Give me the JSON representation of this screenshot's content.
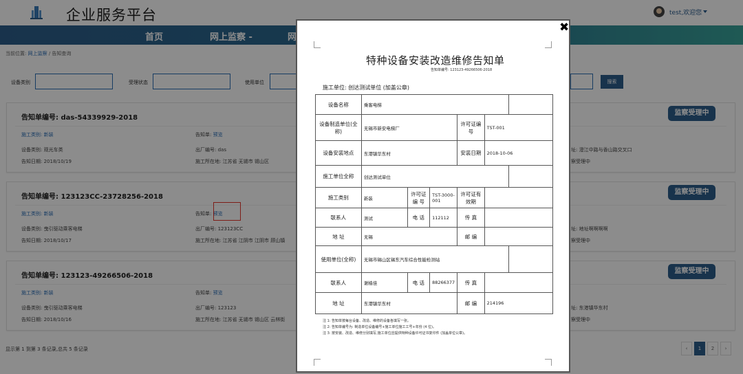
{
  "header": {
    "app_title": "企业服务平台",
    "user_label": "test,欢迎您"
  },
  "nav": {
    "items": [
      "首页",
      "网上监察 -",
      "网"
    ]
  },
  "breadcrumb": {
    "prefix": "当前位置:",
    "section": "网上监察",
    "separator": "/",
    "current": "告知查询"
  },
  "filters": {
    "equipment_type_label": "设备类别",
    "status_label": "受理状态",
    "user_unit_label": "使用单位",
    "search_label": "搜索"
  },
  "cards": [
    {
      "title": "告知单编号: das-54339929-2018",
      "construction_type": "施工类别: 新装",
      "notice_prefix": "告知单:",
      "notice_link": "预览",
      "equipment_type": "设备类别: 观光车类",
      "factory_no": "出厂编号: das",
      "notice_date": "告知日期: 2018/10/19",
      "location": "施工所在地: 江苏省 无锡市 锡山区",
      "right_addr": "址: 澄江中路与香山路交叉口",
      "right_status": "察受理中",
      "badge": "监察受理中"
    },
    {
      "title": "告知单编号: 123123CC-23728256-2018",
      "construction_type": "施工类别: 新装",
      "notice_prefix": "告知单:",
      "notice_link": "预览",
      "equipment_type": "设备类别: 曳引驱动乘客电梯",
      "factory_no": "出厂编号: 123123CC",
      "notice_date": "告知日期: 2018/10/17",
      "location": "施工所在地: 江苏省 江阴市 江阴市 顾山镇",
      "right_addr": "址: 地址啊啊啊啊",
      "right_status": "察受理中",
      "badge": "监察受理中"
    },
    {
      "title": "告知单编号: 123123-49266506-2018",
      "construction_type": "施工类别: 新装",
      "notice_prefix": "告知单:",
      "notice_link": "预览",
      "equipment_type": "设备类别: 曳引驱动乘客电梯",
      "factory_no": "出厂编号: 123123",
      "notice_date": "告知日期: 2018/10/16",
      "location": "施工所在地: 江苏省 无锡市 锡山区 云林街",
      "right_addr": "址: 东港镇华东村",
      "right_status": "察受理中",
      "badge": "监察受理中"
    }
  ],
  "pager": {
    "info": "显示第 1 到第 3 条记录,总共 5 条记录",
    "prev": "‹",
    "pages": [
      "1",
      "2"
    ],
    "next": "›"
  },
  "modal": {
    "close": "✖",
    "doc_title": "特种设备安装改造维修告知单",
    "doc_no": "告知单编号: 123123-49266506-2018",
    "construction_unit_line": "施工单位: 创达测试单位 (加盖公章)",
    "table": {
      "device_name_label": "设备名称",
      "device_name": "乘客电梯",
      "manufacturer_label": "设备制造单位(全称)",
      "manufacturer": "无锡市新安电梯厂",
      "license_label": "许可证编 号",
      "license_no": "TST-001",
      "install_place_label": "设备安装地点",
      "install_place": "东港镇华东村",
      "install_date_label": "安装日期",
      "install_date": "2018-10-06",
      "construction_unit_label": "施工单位全称",
      "construction_unit": "创达测试单位",
      "construction_type_label": "施工类别",
      "construction_type": "新装",
      "license2_label": "许可证编 号",
      "license2_no": "TST-3000-001",
      "validity_label": "许可证有效期",
      "validity": "",
      "contact_label": "联系人",
      "contact": "测试",
      "phone_label": "电 话",
      "phone": "112112",
      "fax_label": "传 真",
      "fax": "",
      "address_label": "地 址",
      "address": "无锡",
      "postcode_label": "邮 编",
      "postcode": "",
      "user_unit_label": "使用单位(全称)",
      "user_unit": "无锡市锡山区锡东汽车综合性能检测站",
      "contact2_label": "联系人",
      "contact2": "谢樯佳",
      "phone2_label": "电 话",
      "phone2": "88266377",
      "fax2_label": "传 真",
      "fax2": "",
      "address2_label": "地 址",
      "address2": "东港镇华东村",
      "postcode2_label": "邮 编",
      "postcode2": "214196"
    },
    "notes": [
      "注 1: 告知单按每台设备、改造、维修的设备各填写一张。",
      "注 2: 告知单编号为: 制造单位设备编号+施工单位施工工号+年份 (4 位)。",
      "注 3: 按安装、改造、维修分别填写,施工单位应提供特种设备许可证书复印件 (加盖单位公章)。"
    ]
  }
}
